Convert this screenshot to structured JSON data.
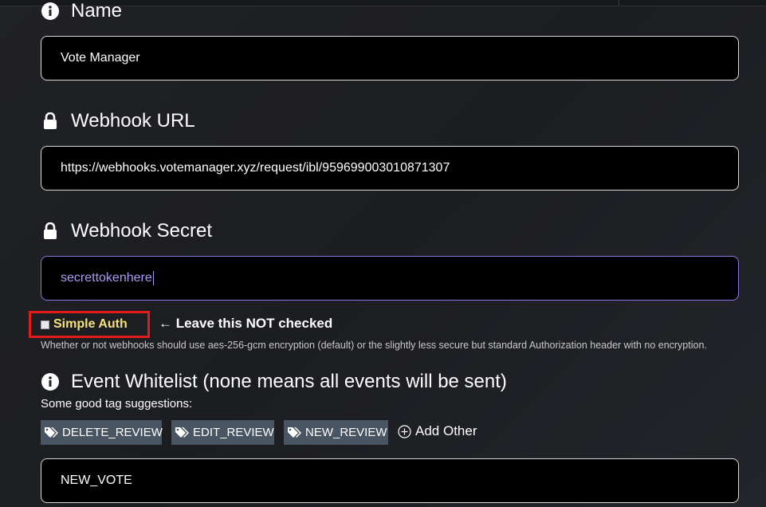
{
  "form": {
    "name": {
      "label": "Name",
      "icon": "info-icon",
      "value": "Vote Manager"
    },
    "webhook_url": {
      "label": "Webhook URL",
      "icon": "lock-icon",
      "value": "https://webhooks.votemanager.xyz/request/ibl/959699003010871307"
    },
    "webhook_secret": {
      "label": "Webhook Secret",
      "icon": "lock-icon",
      "value": "secrettokenhere"
    },
    "simple_auth": {
      "label": "Simple Auth",
      "checked": false,
      "annotation": "← Leave this NOT checked",
      "help": "Whether or not webhooks should use aes-256-gcm encryption (default) or the slightly less secure but standard Authorization header with no encryption."
    },
    "event_whitelist": {
      "label": "Event Whitelist (none means all events will be sent)",
      "icon": "info-icon",
      "suggestions_label": "Some good tag suggestions:",
      "suggestions": [
        {
          "label": "DELETE_REVIEW",
          "icon": "tags-icon"
        },
        {
          "label": "EDIT_REVIEW",
          "icon": "tags-icon"
        },
        {
          "label": "NEW_REVIEW",
          "icon": "tags-icon"
        }
      ],
      "add_other_label": "Add Other",
      "value": "NEW_VOTE"
    }
  },
  "colors": {
    "background": "#1f2024",
    "field_bg": "#000000",
    "active_border": "#8a78e0",
    "tag_bg": "#4a5563",
    "highlight_box": "#e11a1a",
    "auth_label": "#f6e27a"
  }
}
